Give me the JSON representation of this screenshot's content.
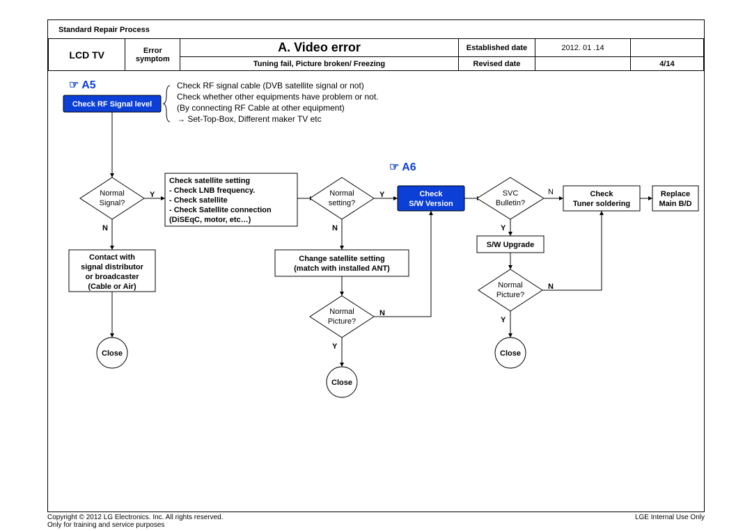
{
  "document_header": "Standard Repair Process",
  "device": "LCD  TV",
  "error_sym_label": "Error symptom",
  "title": "A. Video error",
  "est_label": "Established date",
  "est_value": "2012. 01 .14",
  "symptom_detail": "Tuning fail, Picture broken/ Freezing",
  "rev_label": "Revised date",
  "page_num": "4/14",
  "ref_a5": "☞ A5",
  "ref_a6": "☞ A6",
  "note_l1": "Check RF signal cable (DVB satellite signal or not)",
  "note_l2": "Check whether other equipments have problem or not.",
  "note_l3": "(By connecting RF Cable at other equipment)",
  "note_l4": "→ Set-Top-Box, Different maker TV etc",
  "n_rf": "Check RF Signal level",
  "d_sig_l1": "Normal",
  "d_sig_l2": "Signal?",
  "n_sat_l1": "Check satellite setting",
  "n_sat_l2": "- Check LNB frequency.",
  "n_sat_l3": "- Check satellite",
  "n_sat_l4": "- Check Satellite connection",
  "n_sat_l5": "  (DiSEqC, motor, etc…)",
  "n_contact_l1": "Contact with",
  "n_contact_l2": "signal distributor",
  "n_contact_l3": "or broadcaster",
  "n_contact_l4": "(Cable or Air)",
  "close": "Close",
  "d_set_l1": "Normal",
  "d_set_l2": "setting?",
  "n_change_l1": "Change satellite setting",
  "n_change_l2": "(match with installed ANT)",
  "d_pic_l1": "Normal",
  "d_pic_l2": "Picture?",
  "n_sw_l1": "Check",
  "n_sw_l2": "S/W Version",
  "d_svc_l1": "SVC",
  "d_svc_l2": "Bulletin?",
  "n_upg": "S/W Upgrade",
  "n_tuner_l1": "Check",
  "n_tuner_l2": "Tuner soldering",
  "n_rep_l1": "Replace",
  "n_rep_l2": "Main B/D",
  "lbl_y": "Y",
  "lbl_n": "N",
  "copyright": "Copyright © 2012 LG Electronics. Inc. All rights reserved.",
  "training": "Only for training and service purposes",
  "internal": "LGE Internal Use Only"
}
